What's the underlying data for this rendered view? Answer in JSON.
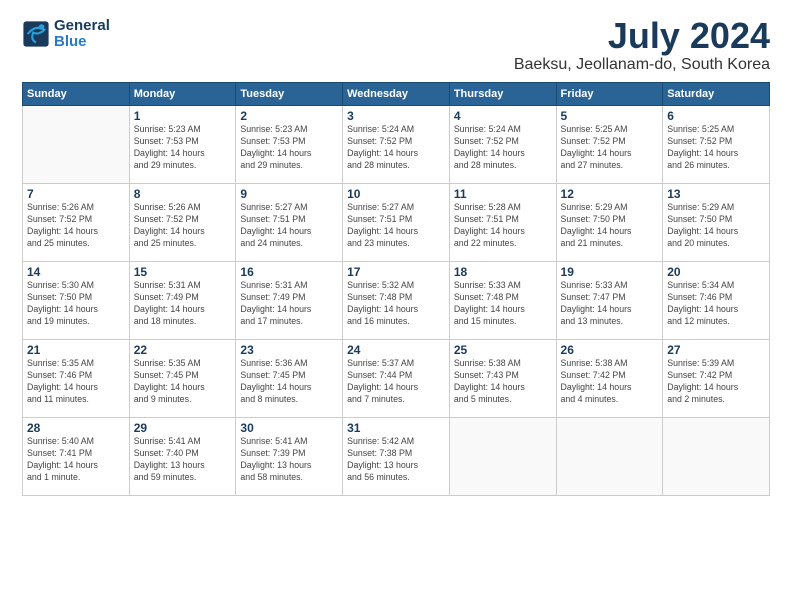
{
  "header": {
    "logo_general": "General",
    "logo_blue": "Blue",
    "title": "July 2024",
    "location": "Baeksu, Jeollanam-do, South Korea"
  },
  "weekdays": [
    "Sunday",
    "Monday",
    "Tuesday",
    "Wednesday",
    "Thursday",
    "Friday",
    "Saturday"
  ],
  "weeks": [
    [
      {
        "day": "",
        "info": ""
      },
      {
        "day": "1",
        "info": "Sunrise: 5:23 AM\nSunset: 7:53 PM\nDaylight: 14 hours\nand 29 minutes."
      },
      {
        "day": "2",
        "info": "Sunrise: 5:23 AM\nSunset: 7:53 PM\nDaylight: 14 hours\nand 29 minutes."
      },
      {
        "day": "3",
        "info": "Sunrise: 5:24 AM\nSunset: 7:52 PM\nDaylight: 14 hours\nand 28 minutes."
      },
      {
        "day": "4",
        "info": "Sunrise: 5:24 AM\nSunset: 7:52 PM\nDaylight: 14 hours\nand 28 minutes."
      },
      {
        "day": "5",
        "info": "Sunrise: 5:25 AM\nSunset: 7:52 PM\nDaylight: 14 hours\nand 27 minutes."
      },
      {
        "day": "6",
        "info": "Sunrise: 5:25 AM\nSunset: 7:52 PM\nDaylight: 14 hours\nand 26 minutes."
      }
    ],
    [
      {
        "day": "7",
        "info": "Sunrise: 5:26 AM\nSunset: 7:52 PM\nDaylight: 14 hours\nand 25 minutes."
      },
      {
        "day": "8",
        "info": "Sunrise: 5:26 AM\nSunset: 7:52 PM\nDaylight: 14 hours\nand 25 minutes."
      },
      {
        "day": "9",
        "info": "Sunrise: 5:27 AM\nSunset: 7:51 PM\nDaylight: 14 hours\nand 24 minutes."
      },
      {
        "day": "10",
        "info": "Sunrise: 5:27 AM\nSunset: 7:51 PM\nDaylight: 14 hours\nand 23 minutes."
      },
      {
        "day": "11",
        "info": "Sunrise: 5:28 AM\nSunset: 7:51 PM\nDaylight: 14 hours\nand 22 minutes."
      },
      {
        "day": "12",
        "info": "Sunrise: 5:29 AM\nSunset: 7:50 PM\nDaylight: 14 hours\nand 21 minutes."
      },
      {
        "day": "13",
        "info": "Sunrise: 5:29 AM\nSunset: 7:50 PM\nDaylight: 14 hours\nand 20 minutes."
      }
    ],
    [
      {
        "day": "14",
        "info": "Sunrise: 5:30 AM\nSunset: 7:50 PM\nDaylight: 14 hours\nand 19 minutes."
      },
      {
        "day": "15",
        "info": "Sunrise: 5:31 AM\nSunset: 7:49 PM\nDaylight: 14 hours\nand 18 minutes."
      },
      {
        "day": "16",
        "info": "Sunrise: 5:31 AM\nSunset: 7:49 PM\nDaylight: 14 hours\nand 17 minutes."
      },
      {
        "day": "17",
        "info": "Sunrise: 5:32 AM\nSunset: 7:48 PM\nDaylight: 14 hours\nand 16 minutes."
      },
      {
        "day": "18",
        "info": "Sunrise: 5:33 AM\nSunset: 7:48 PM\nDaylight: 14 hours\nand 15 minutes."
      },
      {
        "day": "19",
        "info": "Sunrise: 5:33 AM\nSunset: 7:47 PM\nDaylight: 14 hours\nand 13 minutes."
      },
      {
        "day": "20",
        "info": "Sunrise: 5:34 AM\nSunset: 7:46 PM\nDaylight: 14 hours\nand 12 minutes."
      }
    ],
    [
      {
        "day": "21",
        "info": "Sunrise: 5:35 AM\nSunset: 7:46 PM\nDaylight: 14 hours\nand 11 minutes."
      },
      {
        "day": "22",
        "info": "Sunrise: 5:35 AM\nSunset: 7:45 PM\nDaylight: 14 hours\nand 9 minutes."
      },
      {
        "day": "23",
        "info": "Sunrise: 5:36 AM\nSunset: 7:45 PM\nDaylight: 14 hours\nand 8 minutes."
      },
      {
        "day": "24",
        "info": "Sunrise: 5:37 AM\nSunset: 7:44 PM\nDaylight: 14 hours\nand 7 minutes."
      },
      {
        "day": "25",
        "info": "Sunrise: 5:38 AM\nSunset: 7:43 PM\nDaylight: 14 hours\nand 5 minutes."
      },
      {
        "day": "26",
        "info": "Sunrise: 5:38 AM\nSunset: 7:42 PM\nDaylight: 14 hours\nand 4 minutes."
      },
      {
        "day": "27",
        "info": "Sunrise: 5:39 AM\nSunset: 7:42 PM\nDaylight: 14 hours\nand 2 minutes."
      }
    ],
    [
      {
        "day": "28",
        "info": "Sunrise: 5:40 AM\nSunset: 7:41 PM\nDaylight: 14 hours\nand 1 minute."
      },
      {
        "day": "29",
        "info": "Sunrise: 5:41 AM\nSunset: 7:40 PM\nDaylight: 13 hours\nand 59 minutes."
      },
      {
        "day": "30",
        "info": "Sunrise: 5:41 AM\nSunset: 7:39 PM\nDaylight: 13 hours\nand 58 minutes."
      },
      {
        "day": "31",
        "info": "Sunrise: 5:42 AM\nSunset: 7:38 PM\nDaylight: 13 hours\nand 56 minutes."
      },
      {
        "day": "",
        "info": ""
      },
      {
        "day": "",
        "info": ""
      },
      {
        "day": "",
        "info": ""
      }
    ]
  ]
}
